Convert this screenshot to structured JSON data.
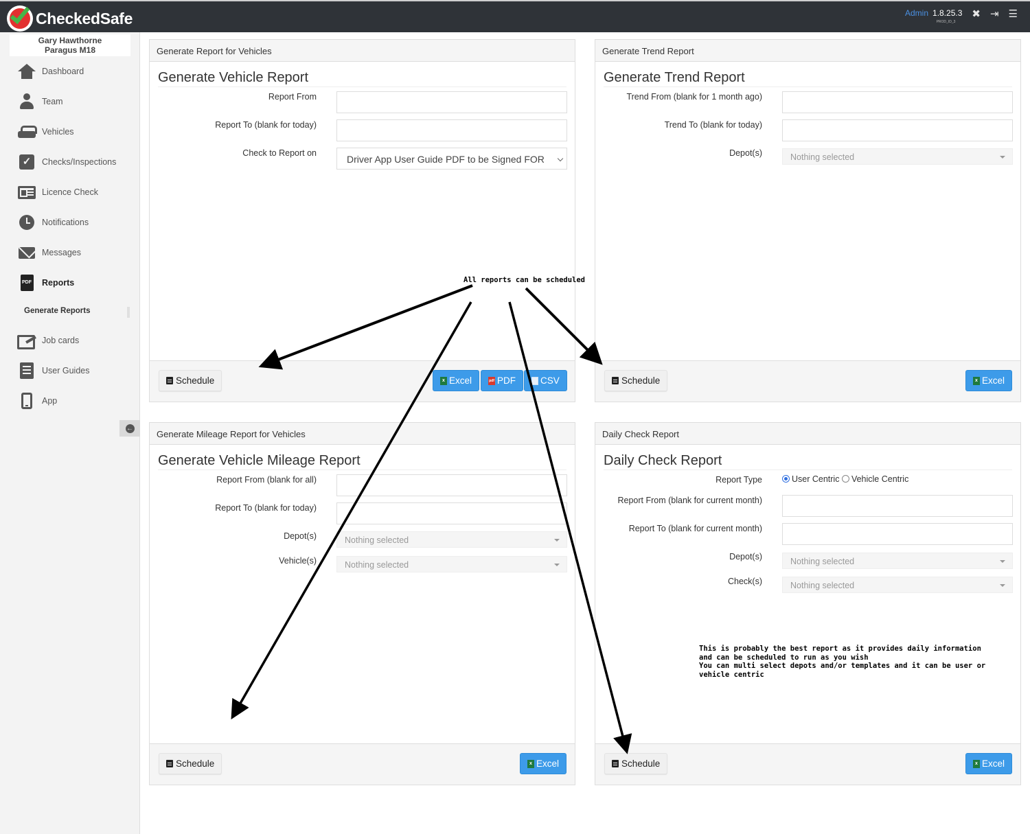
{
  "app": {
    "name": "CheckedSafe",
    "role": "Admin",
    "version": "1.8.25.3",
    "env": "PROD_ID_3"
  },
  "topbar_icons": [
    "expand-icon",
    "logout-icon",
    "menu-icon"
  ],
  "user": {
    "name": "Gary Hawthorne",
    "org": "Paragus M18"
  },
  "sidebar": {
    "items": [
      {
        "label": "Dashboard",
        "icon": "house-icon"
      },
      {
        "label": "Team",
        "icon": "person-icon"
      },
      {
        "label": "Vehicles",
        "icon": "car-icon"
      },
      {
        "label": "Checks/Inspections",
        "icon": "checkbox-icon"
      },
      {
        "label": "Licence Check",
        "icon": "id-card-icon"
      },
      {
        "label": "Notifications",
        "icon": "clock-icon"
      },
      {
        "label": "Messages",
        "icon": "envelope-icon"
      },
      {
        "label": "Reports",
        "icon": "pdf-icon",
        "active": true
      },
      {
        "label": "Job cards",
        "icon": "pen-card-icon"
      },
      {
        "label": "User Guides",
        "icon": "document-icon"
      },
      {
        "label": "App",
        "icon": "phone-icon"
      }
    ],
    "subitem": "Generate Reports",
    "collapse_icon": "arrow-left-circle-icon"
  },
  "pdf_icon_text": "PDF",
  "panels": {
    "vehicle": {
      "header": "Generate Report for Vehicles",
      "title": "Generate Vehicle Report",
      "fields": {
        "from": "Report From",
        "to": "Report To (blank for today)",
        "check": "Check to Report on"
      },
      "check_value": "Driver App User Guide PDF to be Signed FOR",
      "schedule": "Schedule",
      "excel": "Excel",
      "pdf": "PDF",
      "csv": "CSV"
    },
    "trend": {
      "header": "Generate Trend Report",
      "title": "Generate Trend Report",
      "fields": {
        "from": "Trend From (blank for 1 month ago)",
        "to": "Trend To (blank for today)",
        "depots": "Depot(s)"
      },
      "depots_value": "Nothing selected",
      "schedule": "Schedule",
      "excel": "Excel"
    },
    "mileage": {
      "header": "Generate Mileage Report for Vehicles",
      "title": "Generate Vehicle Mileage Report",
      "fields": {
        "from": "Report From (blank for all)",
        "to": "Report To (blank for today)",
        "depots": "Depot(s)",
        "vehicles": "Vehicle(s)"
      },
      "depots_value": "Nothing selected",
      "vehicles_value": "Nothing selected",
      "schedule": "Schedule",
      "excel": "Excel"
    },
    "daily": {
      "header": "Daily Check Report",
      "title": "Daily Check Report",
      "fields": {
        "type": "Report Type",
        "from": "Report From (blank for current month)",
        "to": "Report To (blank for current month)",
        "depots": "Depot(s)",
        "checks": "Check(s)"
      },
      "type_options": [
        "User Centric",
        "Vehicle Centric"
      ],
      "type_selected": "User Centric",
      "depots_value": "Nothing selected",
      "checks_value": "Nothing selected",
      "schedule": "Schedule",
      "excel": "Excel"
    }
  },
  "annotations": {
    "schedule_note": "All reports can be scheduled",
    "daily_note": "This is probably the best report as it provides daily information\nand can be scheduled to run as you wish\nYou can multi select depots and/or templates and it can be user or\nvehicle centric"
  },
  "colors": {
    "topbar": "#2f3338",
    "accent_blue": "#3d9be9",
    "role_blue": "#4a90e2",
    "sidebar_bg": "#f3f3f3"
  }
}
